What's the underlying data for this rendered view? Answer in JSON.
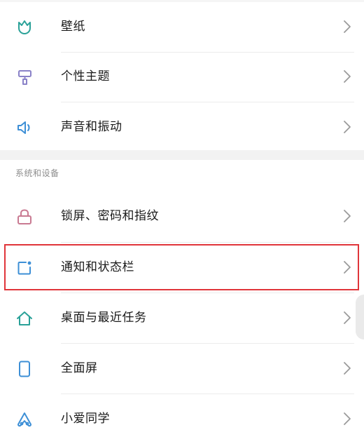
{
  "colors": {
    "teal": "#2aa198",
    "purple": "#8a82c8",
    "rose": "#c97a92",
    "blue": "#3d8fd6",
    "chevron": "#9a9a9a",
    "highlight": "#e0353a"
  },
  "personalization_items": [
    {
      "label": "壁纸",
      "icon": "tulip-icon"
    },
    {
      "label": "个性主题",
      "icon": "paint-roller-icon"
    },
    {
      "label": "声音和振动",
      "icon": "speaker-icon"
    }
  ],
  "system_section": {
    "header": "系统和设备",
    "items": [
      {
        "label": "锁屏、密码和指纹",
        "icon": "lock-icon"
      },
      {
        "label": "通知和状态栏",
        "icon": "notification-icon",
        "highlighted": true
      },
      {
        "label": "桌面与最近任务",
        "icon": "home-icon"
      },
      {
        "label": "全面屏",
        "icon": "phone-icon"
      },
      {
        "label": "小爱同学",
        "icon": "xiaoai-icon"
      }
    ]
  }
}
